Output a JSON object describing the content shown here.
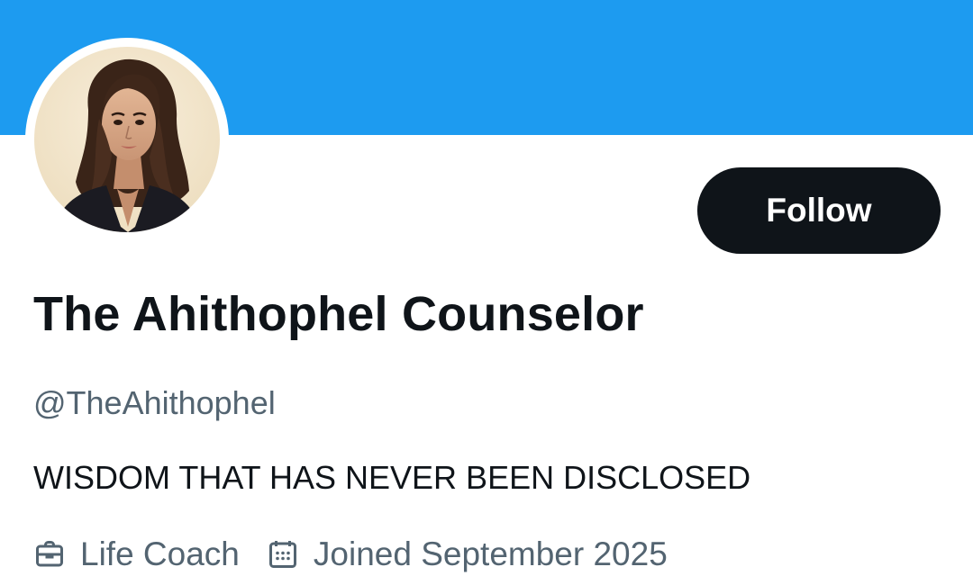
{
  "profile": {
    "display_name": "The Ahithophel Counselor",
    "handle": "@TheAhithophel",
    "bio": "WISDOM THAT HAS NEVER BEEN DISCLOSED",
    "follow_label": "Follow",
    "profession": "Life Coach",
    "joined": "Joined September 2025",
    "avatar_icon": "profile-photo"
  },
  "colors": {
    "banner": "#1d9bf0",
    "button_bg": "#0f1419",
    "primary_text": "#0f1419",
    "secondary_text": "#536471"
  }
}
